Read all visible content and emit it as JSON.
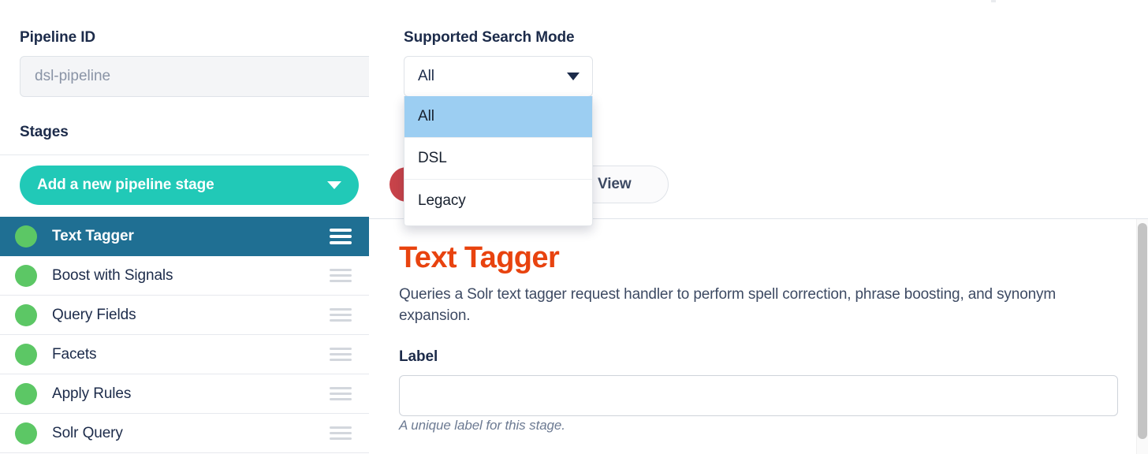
{
  "left_panel": {
    "pipeline_id_label": "Pipeline ID",
    "pipeline_id_value": "dsl-pipeline",
    "stages_label": "Stages",
    "add_stage_button": "Add a new pipeline stage",
    "stages": [
      {
        "name": "Text Tagger",
        "status": "ok",
        "selected": true
      },
      {
        "name": "Boost with Signals",
        "status": "ok",
        "selected": false
      },
      {
        "name": "Query Fields",
        "status": "ok",
        "selected": false
      },
      {
        "name": "Facets",
        "status": "ok",
        "selected": false
      },
      {
        "name": "Apply Rules",
        "status": "ok",
        "selected": false
      },
      {
        "name": "Solr Query",
        "status": "ok",
        "selected": false
      }
    ]
  },
  "right_panel": {
    "search_mode_label": "Supported Search Mode",
    "search_mode_selected": "All",
    "search_mode_options": [
      {
        "label": "All",
        "highlighted": true
      },
      {
        "label": "DSL",
        "highlighted": false
      },
      {
        "label": "Legacy",
        "highlighted": false
      }
    ],
    "json_view_button": "JSON View",
    "stage_title": "Text Tagger",
    "stage_description": "Queries a Solr text tagger request handler to perform spell correction, phrase boosting, and synonym expansion.",
    "label_field_label": "Label",
    "label_field_value": "",
    "label_field_placeholder": "",
    "label_field_help": "A unique label for this stage."
  },
  "colors": {
    "accent_teal": "#21c9b7",
    "selected_row": "#1f6f93",
    "status_green": "#5cc765",
    "title_orange": "#e8430f",
    "dropdown_highlight": "#9ccef2",
    "delete_red": "#c8434a"
  }
}
